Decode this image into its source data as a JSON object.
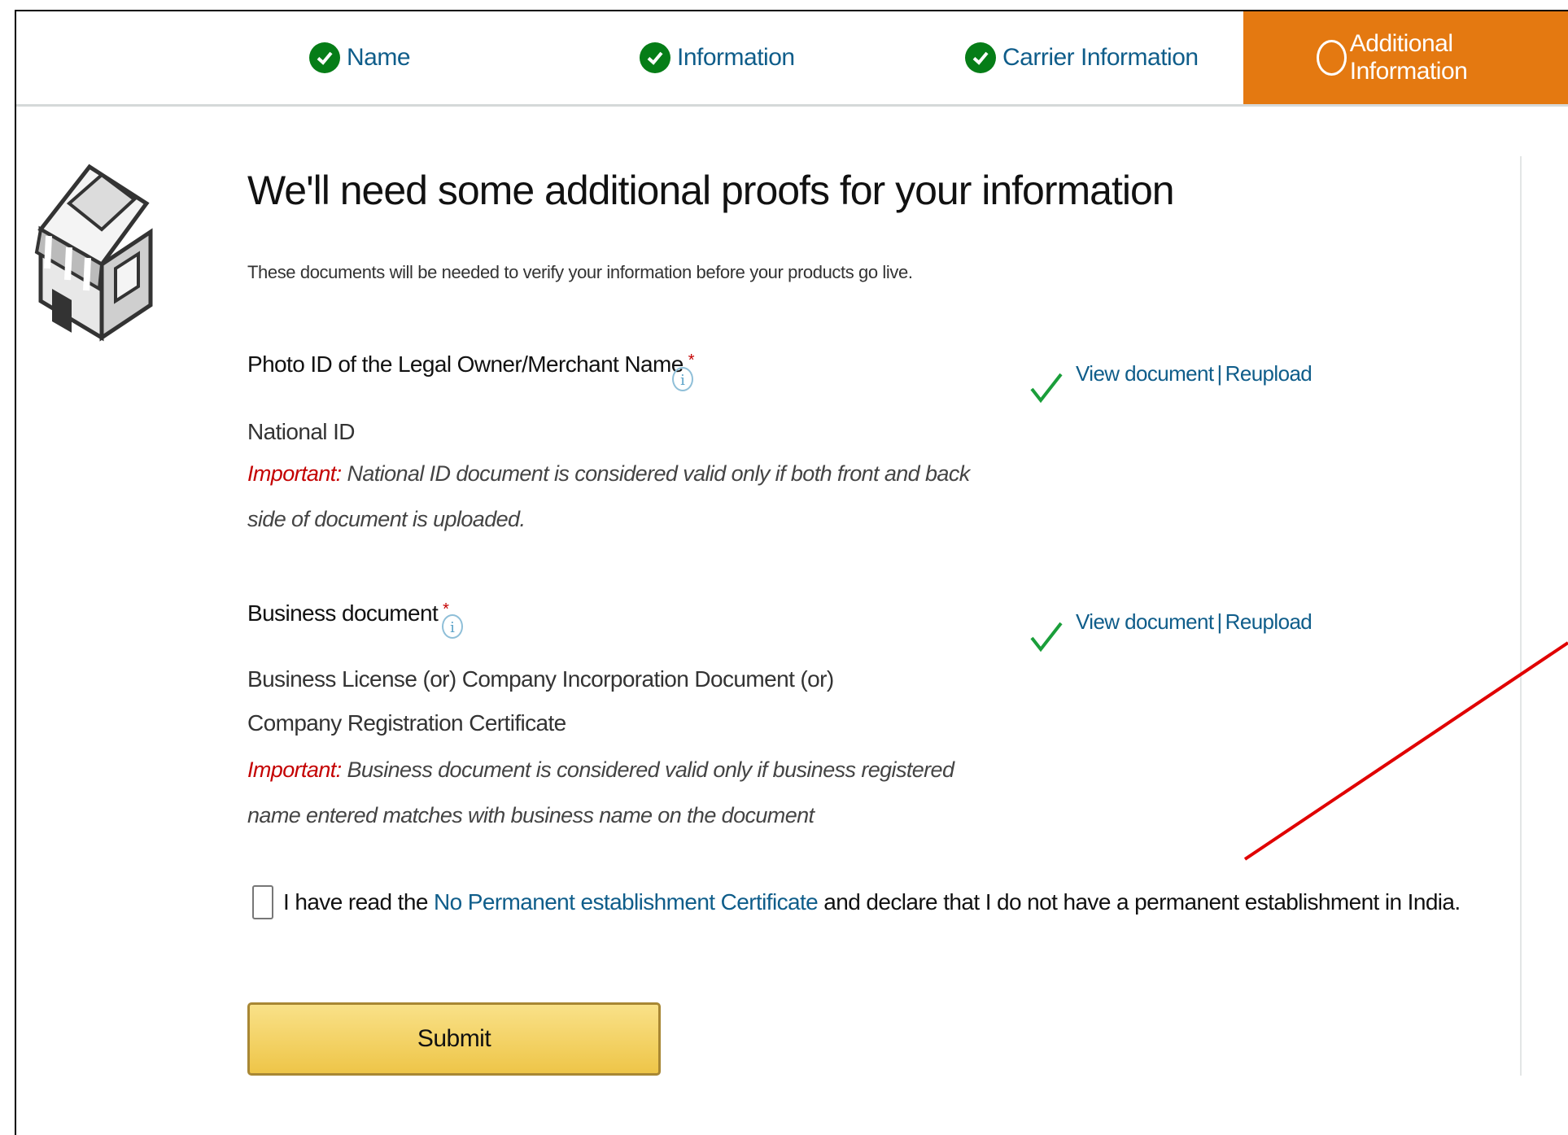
{
  "steps": [
    {
      "label": "Name",
      "state": "complete"
    },
    {
      "label": "Information",
      "state": "complete"
    },
    {
      "label": "Carrier Information",
      "state": "complete"
    },
    {
      "label": "Additional Information",
      "state": "active"
    }
  ],
  "page": {
    "title": "We'll need some additional proofs for your information",
    "subtitle": "These documents will be needed to verify your information before your products go live."
  },
  "documents": [
    {
      "label": "Photo ID of the Legal Owner/Merchant Name",
      "required_mark": "*",
      "info_icon": "info-icon",
      "doc_type": "National ID",
      "important_label": "Important:",
      "important_text": "National ID document is considered valid only if both front and back side of document is uploaded.",
      "view_label": "View document",
      "separator": "|",
      "reupload_label": "Reupload",
      "status_icon": "checkmark-icon"
    },
    {
      "label": "Business document",
      "required_mark": "*",
      "info_icon": "info-icon",
      "doc_type": "Business License (or) Company Incorporation Document (or) Company Registration Certificate",
      "important_label": "Important:",
      "important_text": "Business document is considered valid only if business registered name entered matches with business name on the document",
      "view_label": "View document",
      "separator": "|",
      "reupload_label": "Reupload",
      "status_icon": "checkmark-icon"
    }
  ],
  "declaration": {
    "checked": false,
    "prefix": "I have read the",
    "link": "No Permanent establishment Certificate",
    "suffix": "and declare that I do not have a permanent establishment in India."
  },
  "submit_label": "Submit",
  "colors": {
    "accent": "#e47911",
    "success": "#067d17",
    "link": "#0f5d8a",
    "important": "#c40000",
    "annotation_arrow": "#e00000"
  }
}
